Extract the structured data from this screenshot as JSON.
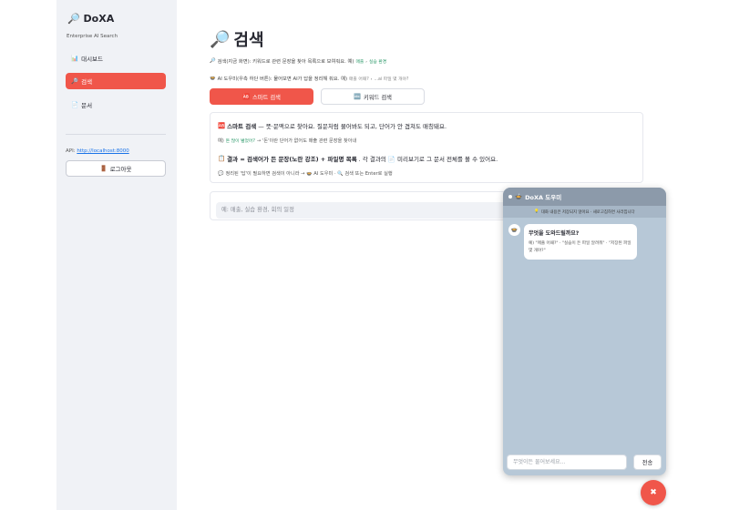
{
  "sidebar": {
    "brand_icon": "🔎",
    "brand": "DoXA",
    "subtitle": "Enterprise AI Search",
    "items": [
      {
        "icon": "📊",
        "label": "대시보드",
        "active": false
      },
      {
        "icon": "🔎",
        "label": "검색",
        "active": true
      },
      {
        "icon": "📄",
        "label": "문서",
        "active": false
      }
    ],
    "api_label": "API:",
    "api_url": "http://localhost:8000",
    "logout_icon": "🚪",
    "logout_label": "로그아웃"
  },
  "main": {
    "title_icon": "🔎",
    "title": "검색",
    "desc1_icon": "🔎",
    "desc1": "검색(지금 화면): 키워드로 관련 문장을 찾아 목록으로 보여줘요. 예)",
    "desc1_chip1": "매출",
    "desc1_chip2": "실습 환경",
    "desc2_icon": "🍲",
    "desc2": "AI 도우미(우측 하단 버튼): 물어보면 AI가 답을 정리해 줘요. 예)",
    "desc2_chip1": "매출 어때?",
    "desc2_chip2": "...ai 파일 몇 개야?",
    "tab_smart_icon": "🆎",
    "tab_smart": "스마트 검색",
    "tab_keyword_icon": "🔤",
    "tab_keyword": "키워드 검색",
    "info": {
      "line1_icon": "🆎",
      "line1_bold": "스마트 검색",
      "line1_rest": "— 뜻·문맥으로 찾아요. 질문처럼 물어봐도 되고, 단어가 안 겹쳐도 매칭돼요.",
      "line2_prefix": "예)",
      "line2_chip": "돈 많이 벌었어?",
      "line2_rest": "→ '돈'이란 단어가 없어도 매출 관련 문장을 찾아내",
      "line3_icon": "📋",
      "line3_bold": "결과 = 검색어가 든 문장(노란 강조) + 파일명 목록",
      "line3_rest": ". 각 결과의 📄 미리보기로 그 문서 전체를 볼 수 있어요.",
      "line4_icon": "💬",
      "line4": "정리된 '답'이 필요하면 검색이 아니라 → 🍲 AI 도우미 · 🔍 검색 또는 Enter로 실행"
    },
    "search_placeholder": "예: 매출, 실습 환경, 회의 일정"
  },
  "chat": {
    "header_icon": "🍲",
    "header": "DoXA 도우미",
    "notice_icon": "💡",
    "notice": "대화 내용은 저장되지 않아요 · 새로고침하면 사라집니다",
    "bot_icon": "🍲",
    "bubble_title": "무엇을 도와드릴까요?",
    "bubble_text": "예) \"매출 어때?\" · \"실습이 든 파일 알려줘\" · \"저장된 파일 몇 개야?\"",
    "input_placeholder": "무엇이든 물어보세요...",
    "send_label": "전송"
  },
  "fab_icon": "✖",
  "colors": {
    "accent": "#f0564a",
    "sidebar_bg": "#f0f2f6",
    "chat_bg": "#b7c8d7",
    "chat_header": "#8c9aaa",
    "link": "#1a73e8"
  }
}
